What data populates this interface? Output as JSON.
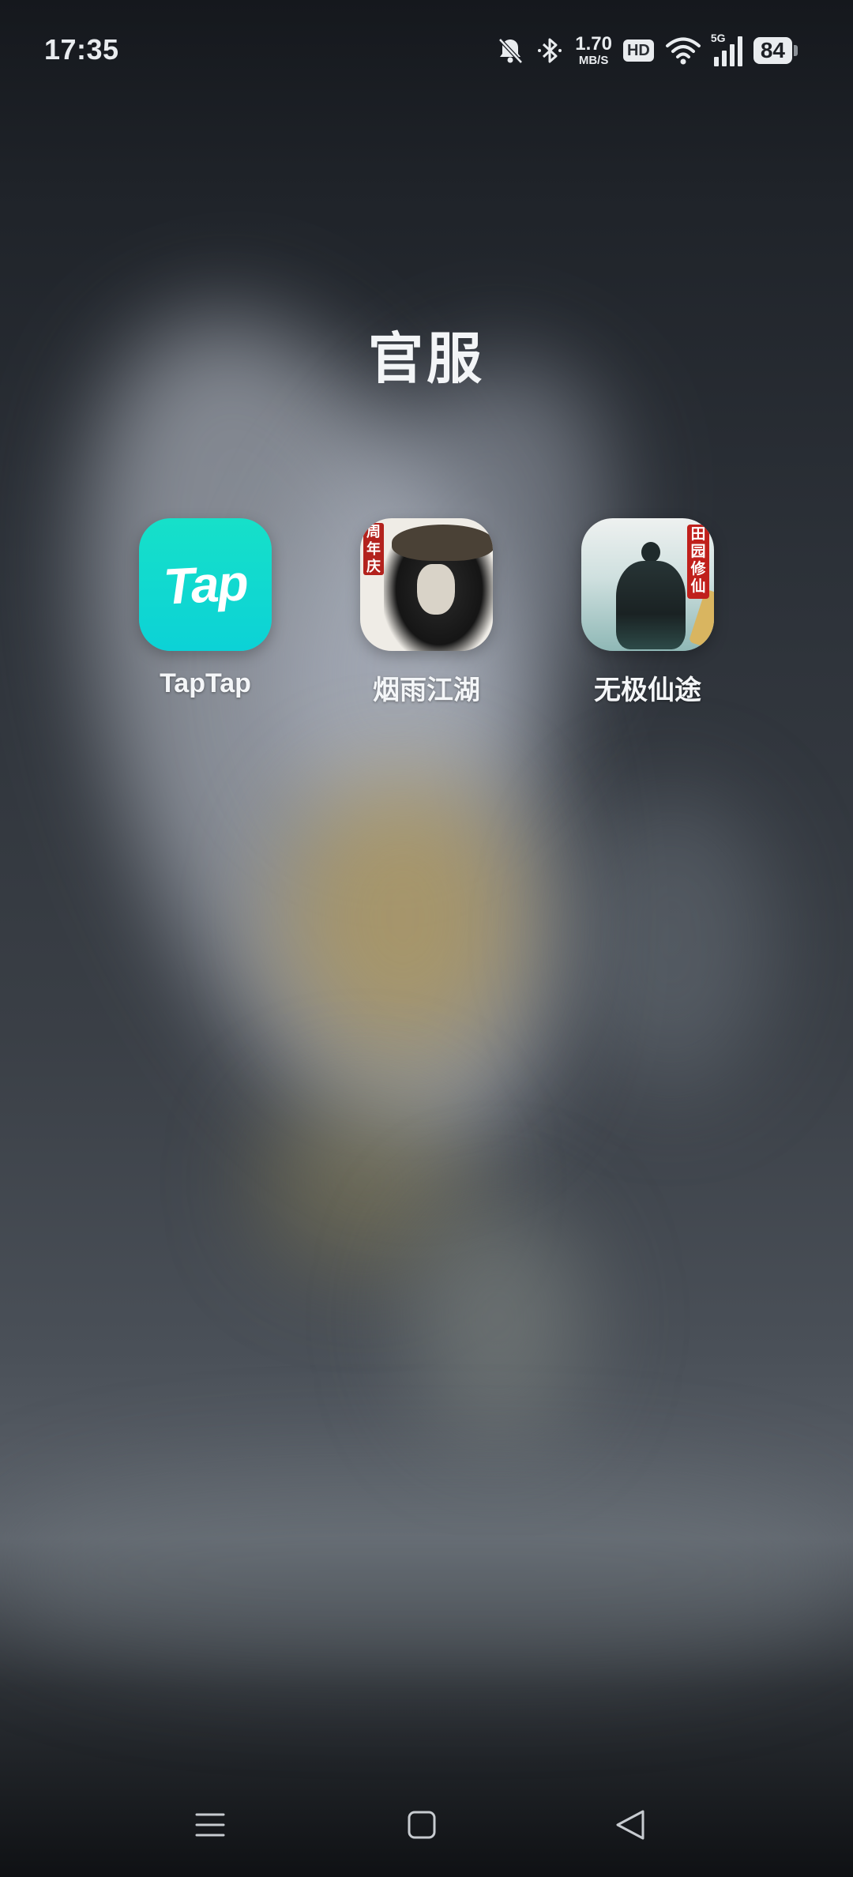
{
  "status_bar": {
    "time": "17:35",
    "net_speed_value": "1.70",
    "net_speed_unit": "MB/S",
    "hd_label": "HD",
    "network_type": "5G",
    "battery_level": "84",
    "icons": [
      "mute-bell-icon",
      "bluetooth-icon",
      "wifi-icon",
      "cellular-signal-icon",
      "battery-icon"
    ]
  },
  "folder": {
    "title": "官服",
    "apps": [
      {
        "label": "TapTap",
        "icon_text": "Tap",
        "icon": "taptap-app-icon",
        "accent": "#12dbcf"
      },
      {
        "label": "烟雨江湖",
        "icon_text": "周年庆",
        "icon": "yanyu-jianghu-app-icon",
        "accent": "#b3221d"
      },
      {
        "label": "无极仙途",
        "icon_text": "田园修仙",
        "icon": "wuji-xiantu-app-icon",
        "accent": "#c0201c"
      }
    ]
  },
  "nav_bar": {
    "buttons": [
      "menu-icon",
      "home-icon",
      "back-icon"
    ]
  }
}
